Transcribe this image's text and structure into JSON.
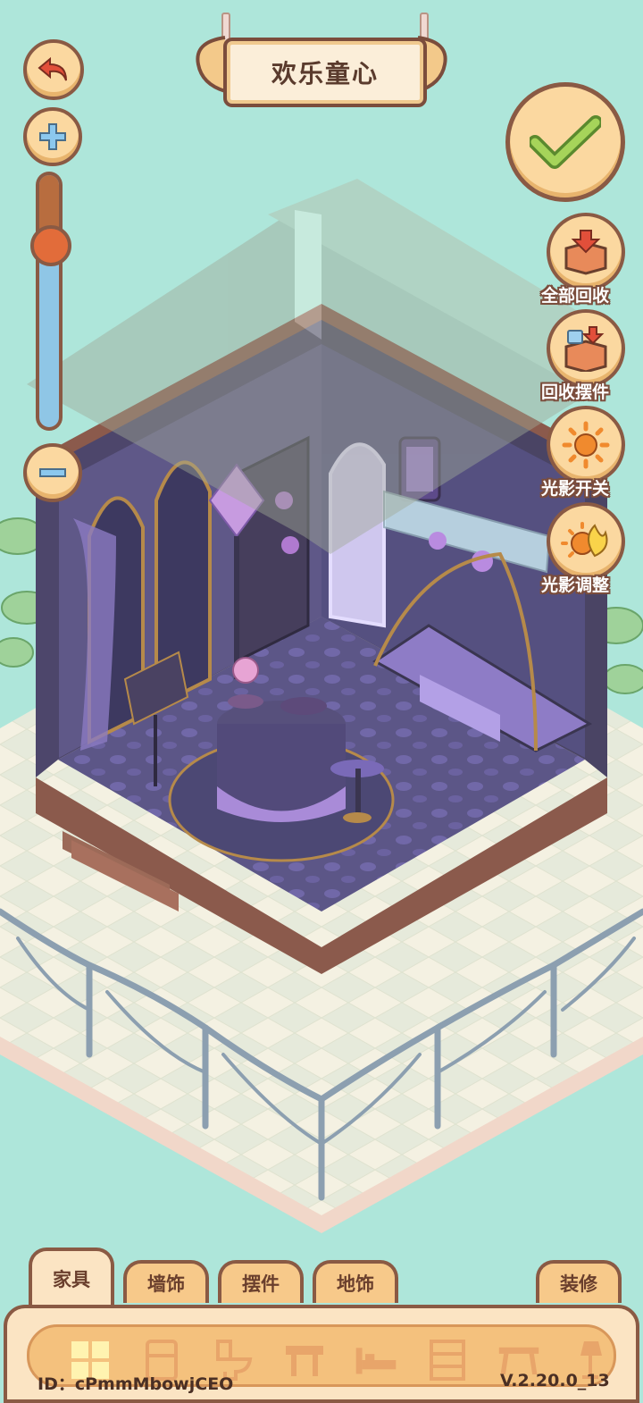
{
  "room": {
    "title": "欢乐童心"
  },
  "side_buttons": [
    {
      "id": "recycle-all",
      "label": "全部回收",
      "icon": "box-down-arrow-icon"
    },
    {
      "id": "recycle-decor",
      "label": "回收摆件",
      "icon": "cup-box-icon"
    },
    {
      "id": "light-toggle",
      "label": "光影开关",
      "icon": "sun-icon"
    },
    {
      "id": "light-adjust",
      "label": "光影调整",
      "icon": "sun-moon-icon"
    }
  ],
  "zoom": {
    "level": 0.28
  },
  "tabs": [
    {
      "label": "家具",
      "active": true
    },
    {
      "label": "墙饰",
      "active": false
    },
    {
      "label": "摆件",
      "active": false
    },
    {
      "label": "地饰",
      "active": false
    },
    {
      "label": "装修",
      "active": false
    }
  ],
  "categories": [
    "all-grid-icon",
    "fridge-icon",
    "toilet-icon",
    "stool-icon",
    "bed-icon",
    "cabinet-icon",
    "table-icon",
    "lamp-icon"
  ],
  "footer": {
    "id_text": "ID：cPmmMbowjCEO",
    "version": "V.2.20.0_13"
  },
  "colors": {
    "background": "#aee6da",
    "accent": "#fbd8a0",
    "border": "#8a5a44"
  }
}
